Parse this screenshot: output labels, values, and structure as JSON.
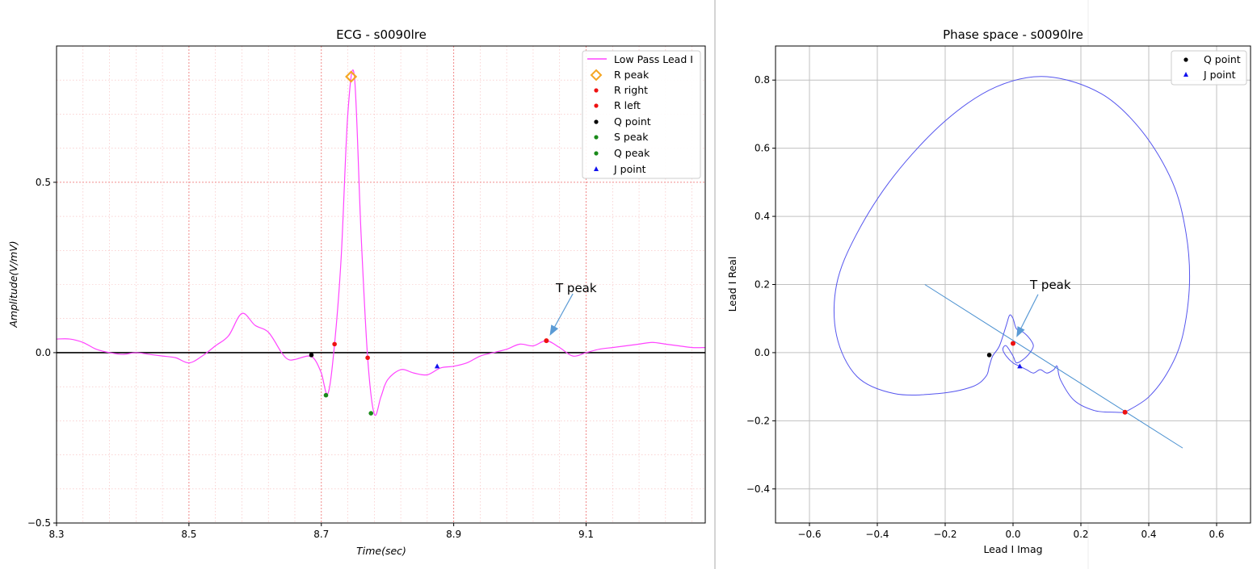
{
  "chart_data": [
    {
      "type": "line",
      "title": "ECG - s0090lre",
      "xlabel": "Time(sec)",
      "ylabel": "Amplitude(V/mV)",
      "xlim": [
        8.3,
        9.28
      ],
      "ylim": [
        -0.5,
        0.9
      ],
      "x_ticks": [
        8.3,
        8.5,
        8.7,
        8.9,
        9.1
      ],
      "x_tick_labels": [
        "8.3",
        "8.5",
        "8.7",
        "8.9",
        "9.1"
      ],
      "y_ticks": [
        -0.5,
        0.0,
        0.5
      ],
      "y_tick_labels": [
        "−0.5",
        "0.0",
        "0.5"
      ],
      "grid": "major and minor (red dotted)",
      "legend_position": "top-right",
      "colors": {
        "signal": "#ff44ff",
        "grid": "#f08080",
        "baseline": "#000000"
      },
      "series": [
        {
          "name": "Low Pass Lead I",
          "color": "#ff44ff",
          "x": [
            8.3,
            8.32,
            8.34,
            8.36,
            8.38,
            8.4,
            8.42,
            8.44,
            8.46,
            8.48,
            8.5,
            8.52,
            8.54,
            8.56,
            8.58,
            8.6,
            8.62,
            8.64,
            8.65,
            8.66,
            8.68,
            8.69,
            8.7,
            8.71,
            8.72,
            8.73,
            8.74,
            8.75,
            8.76,
            8.77,
            8.78,
            8.79,
            8.8,
            8.82,
            8.84,
            8.86,
            8.88,
            8.9,
            8.92,
            8.94,
            8.96,
            8.98,
            9.0,
            9.02,
            9.04,
            9.06,
            9.08,
            9.1,
            9.12,
            9.14,
            9.16,
            9.18,
            9.2,
            9.22,
            9.24,
            9.26,
            9.28
          ],
          "y": [
            0.04,
            0.04,
            0.03,
            0.01,
            0.0,
            -0.005,
            0.0,
            -0.005,
            -0.01,
            -0.015,
            -0.03,
            -0.01,
            0.02,
            0.05,
            0.115,
            0.08,
            0.06,
            0.0,
            -0.02,
            -0.02,
            -0.01,
            -0.02,
            -0.06,
            -0.12,
            0.025,
            0.28,
            0.7,
            0.81,
            0.35,
            -0.015,
            -0.18,
            -0.13,
            -0.08,
            -0.05,
            -0.06,
            -0.065,
            -0.045,
            -0.04,
            -0.03,
            -0.01,
            0.0,
            0.01,
            0.025,
            0.02,
            0.035,
            0.015,
            -0.01,
            0.0,
            0.01,
            0.015,
            0.02,
            0.025,
            0.03,
            0.025,
            0.02,
            0.015,
            0.015
          ]
        }
      ],
      "markers": [
        {
          "name": "R peak",
          "x": 8.745,
          "y": 0.81,
          "shape": "diamond",
          "color": "#f5a623"
        },
        {
          "name": "R right",
          "x": 8.72,
          "y": 0.025,
          "shape": "dot",
          "color": "#ee1111"
        },
        {
          "name": "R left",
          "x": 8.77,
          "y": -0.015,
          "shape": "dot",
          "color": "#ee1111"
        },
        {
          "name": "Q point",
          "x": 8.685,
          "y": -0.007,
          "shape": "dot",
          "color": "#000000"
        },
        {
          "name": "S peak",
          "x": 8.707,
          "y": -0.125,
          "shape": "dot",
          "color": "#1a8a1a"
        },
        {
          "name": "Q peak",
          "x": 8.775,
          "y": -0.178,
          "shape": "dot",
          "color": "#1a8a1a"
        },
        {
          "name": "J point",
          "x": 8.875,
          "y": -0.04,
          "shape": "triangle",
          "color": "#1111ee"
        }
      ],
      "t_peak": {
        "x": 9.04,
        "y": 0.035,
        "color": "#ee1111"
      },
      "annotations": [
        {
          "text": "T peak",
          "x": 9.08,
          "y": 0.18,
          "arrow_to": [
            9.045,
            0.04
          ]
        }
      ],
      "legend_entries": [
        "Low Pass Lead I",
        "R peak",
        "R right",
        "R left",
        "Q point",
        "S peak",
        "Q peak",
        "J point"
      ]
    },
    {
      "type": "line",
      "title": "Phase space - s0090lre",
      "xlabel": "Lead I Imag",
      "ylabel": "Lead I Real",
      "xlim": [
        -0.7,
        0.7
      ],
      "ylim": [
        -0.5,
        0.9
      ],
      "x_ticks": [
        -0.6,
        -0.4,
        -0.2,
        0.0,
        0.2,
        0.4,
        0.6
      ],
      "x_tick_labels": [
        "−0.6",
        "−0.4",
        "−0.2",
        "0.0",
        "0.2",
        "0.4",
        "0.6"
      ],
      "y_ticks": [
        -0.4,
        -0.2,
        0.0,
        0.2,
        0.4,
        0.6,
        0.8
      ],
      "y_tick_labels": [
        "−0.4",
        "−0.2",
        "0.0",
        "0.2",
        "0.4",
        "0.6",
        "0.8"
      ],
      "grid": "major (gray)",
      "legend_position": "top-right",
      "colors": {
        "trajectory": "#5555ee",
        "line": "#4a90d0",
        "grid": "#c0c0c0"
      },
      "series": [
        {
          "name": "trajectory",
          "color": "#5555ee",
          "x": [
            0.33,
            0.4,
            0.46,
            0.5,
            0.52,
            0.51,
            0.47,
            0.38,
            0.26,
            0.1,
            -0.05,
            -0.2,
            -0.35,
            -0.46,
            -0.52,
            -0.52,
            -0.46,
            -0.35,
            -0.22,
            -0.12,
            -0.08,
            -0.07,
            -0.06,
            -0.04,
            -0.02,
            -0.01,
            0.0,
            0.01,
            0.03,
            0.05,
            0.06,
            0.05,
            0.03,
            0.01,
            0.0,
            -0.02,
            -0.03,
            -0.02,
            0.0,
            0.02,
            0.04,
            0.06,
            0.08,
            0.1,
            0.12,
            0.13,
            0.14,
            0.18,
            0.24,
            0.3,
            0.33
          ],
          "y": [
            -0.175,
            -0.13,
            -0.05,
            0.05,
            0.2,
            0.35,
            0.5,
            0.65,
            0.76,
            0.81,
            0.78,
            0.68,
            0.52,
            0.35,
            0.2,
            0.05,
            -0.07,
            -0.12,
            -0.12,
            -0.1,
            -0.07,
            -0.04,
            -0.01,
            0.02,
            0.08,
            0.11,
            0.1,
            0.07,
            0.06,
            0.04,
            0.02,
            0.0,
            -0.02,
            -0.03,
            -0.01,
            0.02,
            0.01,
            -0.01,
            -0.03,
            -0.04,
            -0.05,
            -0.06,
            -0.05,
            -0.06,
            -0.05,
            -0.04,
            -0.08,
            -0.14,
            -0.17,
            -0.175,
            -0.175
          ]
        }
      ],
      "regression_line": {
        "x": [
          -0.26,
          0.5
        ],
        "y": [
          0.2,
          -0.28
        ]
      },
      "markers": [
        {
          "name": "Q point",
          "x": -0.07,
          "y": -0.007,
          "shape": "dot",
          "color": "#000000"
        },
        {
          "name": "J point",
          "x": 0.02,
          "y": -0.04,
          "shape": "triangle",
          "color": "#1111ee"
        }
      ],
      "t_peak": {
        "x": 0.33,
        "y": -0.175,
        "color": "#ee1111"
      },
      "annotations": [
        {
          "text": "T peak",
          "x": 0.05,
          "y": 0.19,
          "arrow_to": [
            0.01,
            0.045
          ]
        }
      ],
      "legend_entries": [
        "Q point",
        "J point"
      ]
    }
  ]
}
